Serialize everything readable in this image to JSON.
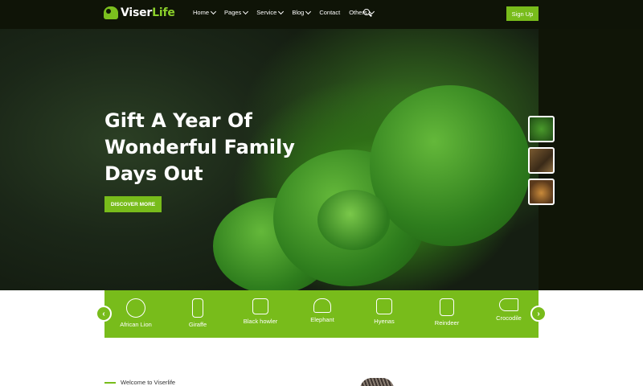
{
  "header": {
    "logo_part1": "Viser",
    "logo_part2": "Life",
    "nav": [
      {
        "label": "Home",
        "dropdown": true
      },
      {
        "label": "Pages",
        "dropdown": true
      },
      {
        "label": "Service",
        "dropdown": true
      },
      {
        "label": "Blog",
        "dropdown": true
      },
      {
        "label": "Contact",
        "dropdown": false
      },
      {
        "label": "Others",
        "dropdown": true
      }
    ],
    "search_icon": "search-icon",
    "signup_label": "Sign Up"
  },
  "hero": {
    "title_line1": "Gift A Year Of",
    "title_line2": "Wonderful Family",
    "title_line3": "Days Out",
    "cta_label": "DISCOVER MORE"
  },
  "animals": [
    {
      "label": "African Lion",
      "icon": "lion-icon"
    },
    {
      "label": "Giraffe",
      "icon": "giraffe-icon"
    },
    {
      "label": "Black howler",
      "icon": "monkey-icon"
    },
    {
      "label": "Elephant",
      "icon": "elephant-icon"
    },
    {
      "label": "Hyenas",
      "icon": "hyena-icon"
    },
    {
      "label": "Reindeer",
      "icon": "reindeer-icon"
    },
    {
      "label": "Crocodile",
      "icon": "crocodile-icon"
    }
  ],
  "welcome": {
    "text": "Welcome to Viserlife"
  },
  "colors": {
    "accent": "#78bc1b",
    "header_bg": "#0f1407"
  }
}
